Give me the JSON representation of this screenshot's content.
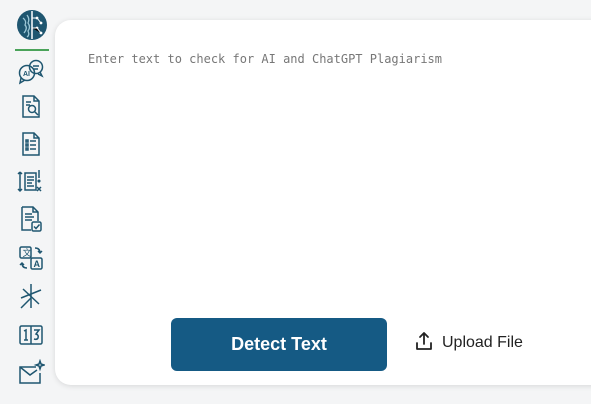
{
  "editor": {
    "placeholder": "Enter text to check for AI and ChatGPT Plagiarism",
    "value": ""
  },
  "actions": {
    "detect_label": "Detect Text",
    "upload_label": "Upload File"
  },
  "sidebar": {
    "icons": [
      "brain-logo-icon",
      "ai-chat-icon",
      "document-search-icon",
      "document-list-icon",
      "alert-report-icon",
      "document-check-icon",
      "translate-icon",
      "sparkle-line-icon",
      "split-page-icon",
      "mail-sparkle-icon"
    ]
  },
  "colors": {
    "accent": "#155a84",
    "icon": "#1f5670",
    "divider": "#4aa35a",
    "background": "#f4f5f6"
  }
}
